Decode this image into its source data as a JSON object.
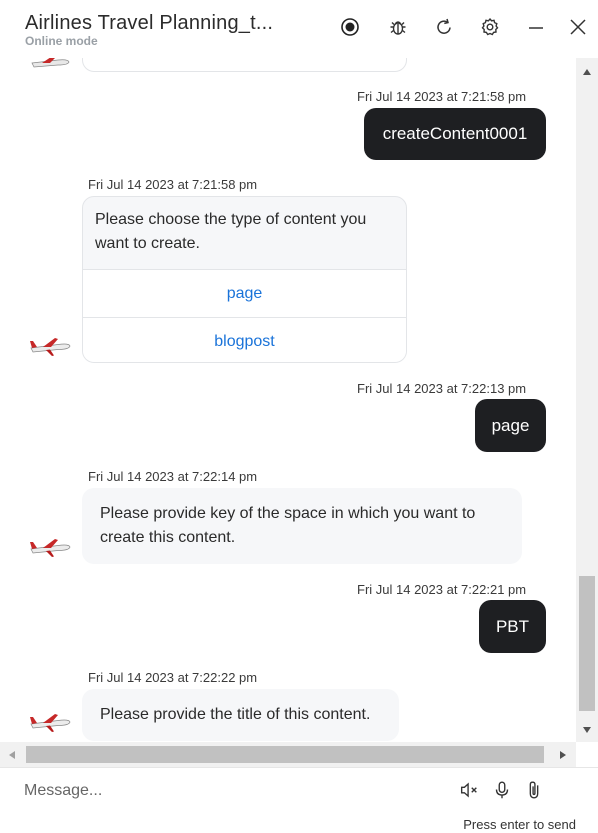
{
  "header": {
    "title": "Airlines Travel Planning_t...",
    "subtitle": "Online mode",
    "icons": [
      "record-icon",
      "bug-icon",
      "refresh-icon",
      "settings-icon",
      "minimize-icon",
      "close-icon"
    ]
  },
  "messages": [
    {
      "from": "user",
      "timestamp": "Fri Jul 14 2023 at 7:21:58 pm",
      "text": "createContent0001"
    },
    {
      "from": "bot",
      "timestamp": "Fri Jul 14 2023 at 7:21:58 pm",
      "text": "Please choose the type of content you want to create.",
      "options": [
        "page",
        "blogpost"
      ]
    },
    {
      "from": "user",
      "timestamp": "Fri Jul 14 2023 at 7:22:13 pm",
      "text": "page"
    },
    {
      "from": "bot",
      "timestamp": "Fri Jul 14 2023 at 7:22:14 pm",
      "text": "Please provide key of the space in which you want to create this content."
    },
    {
      "from": "user",
      "timestamp": "Fri Jul 14 2023 at 7:22:21 pm",
      "text": "PBT"
    },
    {
      "from": "bot",
      "timestamp": "Fri Jul 14 2023 at 7:22:22 pm",
      "text": "Please provide the title of this content."
    }
  ],
  "composer": {
    "placeholder": "Message...",
    "hint": "Press enter to send",
    "icons": [
      "mute-icon",
      "microphone-icon",
      "attachment-icon"
    ]
  },
  "colors": {
    "user_bubble": "#1e1f22",
    "bot_bubble": "#f6f7f9",
    "link": "#1a73d9"
  }
}
